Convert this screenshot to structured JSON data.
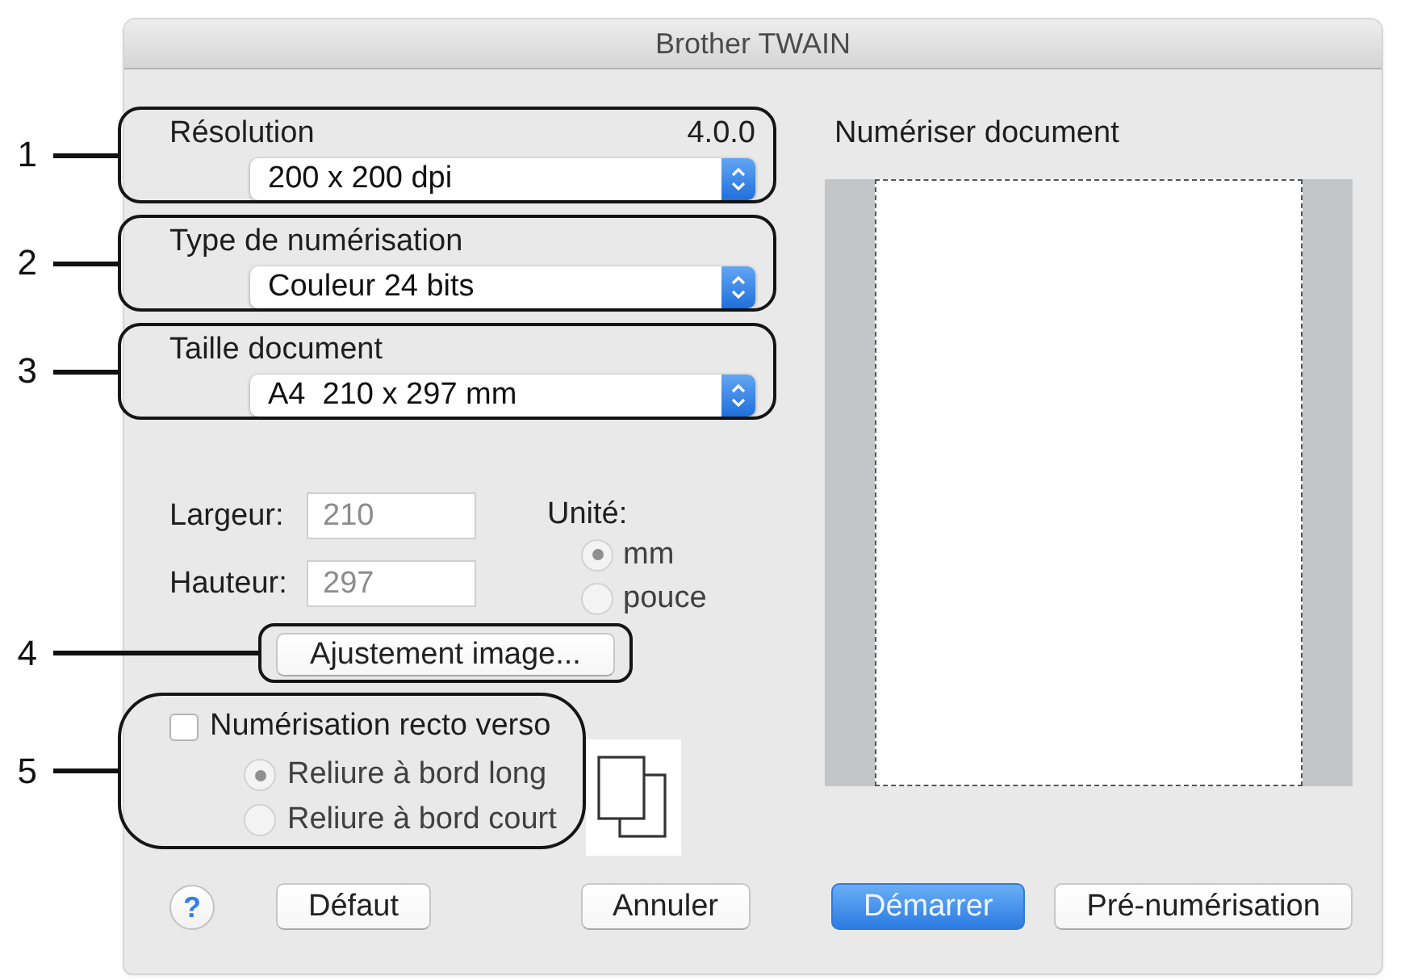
{
  "window": {
    "title": "Brother TWAIN"
  },
  "settings": [
    {
      "callout": "1",
      "label": "Résolution",
      "version": "4.0.0",
      "value": "200 x 200 dpi"
    },
    {
      "callout": "2",
      "label": "Type de numérisation",
      "value": "Couleur 24 bits"
    },
    {
      "callout": "3",
      "label": "Taille document",
      "value": "A4  210 x 297 mm"
    }
  ],
  "dimensions": {
    "fields": [
      {
        "label": "Largeur:",
        "value": "210",
        "disabled": true
      },
      {
        "label": "Hauteur:",
        "value": "297",
        "disabled": true
      }
    ],
    "unit": {
      "label": "Unité:",
      "options": [
        {
          "label": "mm",
          "selected": true,
          "disabled": true
        },
        {
          "label": "pouce",
          "selected": false,
          "disabled": true
        }
      ]
    }
  },
  "image_adjust": {
    "callout": "4",
    "label": "Ajustement image..."
  },
  "duplex": {
    "callout": "5",
    "label": "Numérisation recto verso",
    "checked": false,
    "options": [
      {
        "label": "Reliure à bord long",
        "selected": true,
        "disabled": true
      },
      {
        "label": "Reliure à bord court",
        "selected": false,
        "disabled": true
      }
    ]
  },
  "preview": {
    "label": "Numériser document"
  },
  "footer": {
    "left": [
      {
        "kind": "help",
        "label": "?"
      },
      {
        "kind": "push",
        "label": "Défaut"
      },
      {
        "kind": "push",
        "label": "Annuler"
      }
    ],
    "right": [
      {
        "kind": "default",
        "label": "Démarrer"
      },
      {
        "kind": "push",
        "label": "Pré-numérisation"
      }
    ]
  }
}
